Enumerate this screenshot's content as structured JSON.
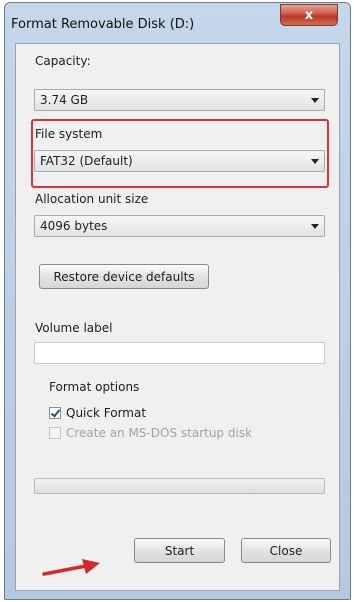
{
  "window": {
    "title": "Format Removable Disk (D:)",
    "close_glyph": "x"
  },
  "capacity": {
    "label": "Capacity:",
    "value": "3.74 GB"
  },
  "file_system": {
    "label": "File system",
    "value": "FAT32 (Default)"
  },
  "allocation": {
    "label": "Allocation unit size",
    "value": "4096 bytes"
  },
  "restore_button": "Restore device defaults",
  "volume": {
    "label": "Volume label",
    "value": ""
  },
  "format_options": {
    "label": "Format options",
    "quick_format": {
      "label": "Quick Format",
      "checked": true
    },
    "msdos_disk": {
      "label": "Create an MS-DOS startup disk",
      "checked": false,
      "enabled": false
    }
  },
  "progress": 0,
  "buttons": {
    "start": "Start",
    "close": "Close"
  },
  "colors": {
    "highlight": "#d8323a",
    "arrow": "#d42a2a",
    "close_button": "#cc5a44"
  },
  "icons": [
    "close-icon",
    "dropdown-arrow-icon",
    "checkmark-icon",
    "red-pointer-arrow-icon"
  ]
}
